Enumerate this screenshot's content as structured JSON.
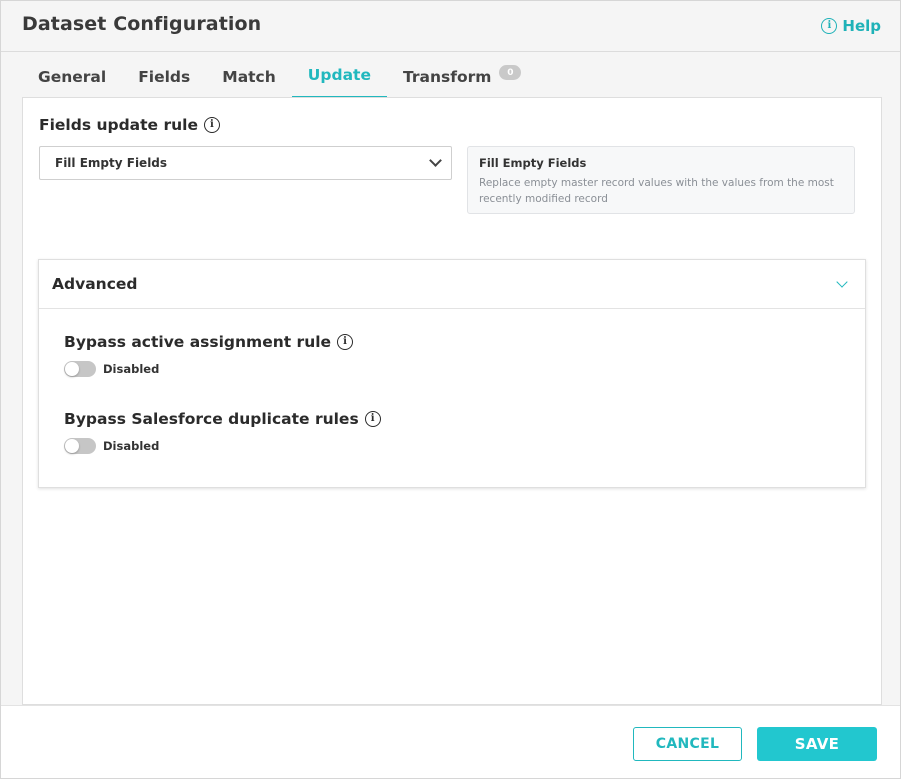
{
  "header": {
    "title": "Dataset Configuration",
    "help_label": "Help"
  },
  "tabs": [
    {
      "label": "General",
      "active": false
    },
    {
      "label": "Fields",
      "active": false
    },
    {
      "label": "Match",
      "active": false
    },
    {
      "label": "Update",
      "active": true
    },
    {
      "label": "Transform",
      "active": false,
      "badge": "0"
    }
  ],
  "update_rule": {
    "label": "Fields update rule",
    "selected": "Fill Empty Fields",
    "description_title": "Fill Empty Fields",
    "description_text": "Replace empty master record values with the values from the most recently modified record"
  },
  "advanced": {
    "title": "Advanced",
    "settings": [
      {
        "label": "Bypass active assignment rule",
        "state": "Disabled",
        "enabled": false
      },
      {
        "label": "Bypass Salesforce duplicate rules",
        "state": "Disabled",
        "enabled": false
      }
    ]
  },
  "footer": {
    "cancel_label": "CANCEL",
    "save_label": "SAVE"
  },
  "colors": {
    "accent": "#21b8be",
    "toggle_off": "#c6c6c6"
  },
  "icons": {
    "help": "info-circle-icon",
    "dropdown": "chevron-down-icon",
    "advanced": "chevron-down-icon"
  }
}
